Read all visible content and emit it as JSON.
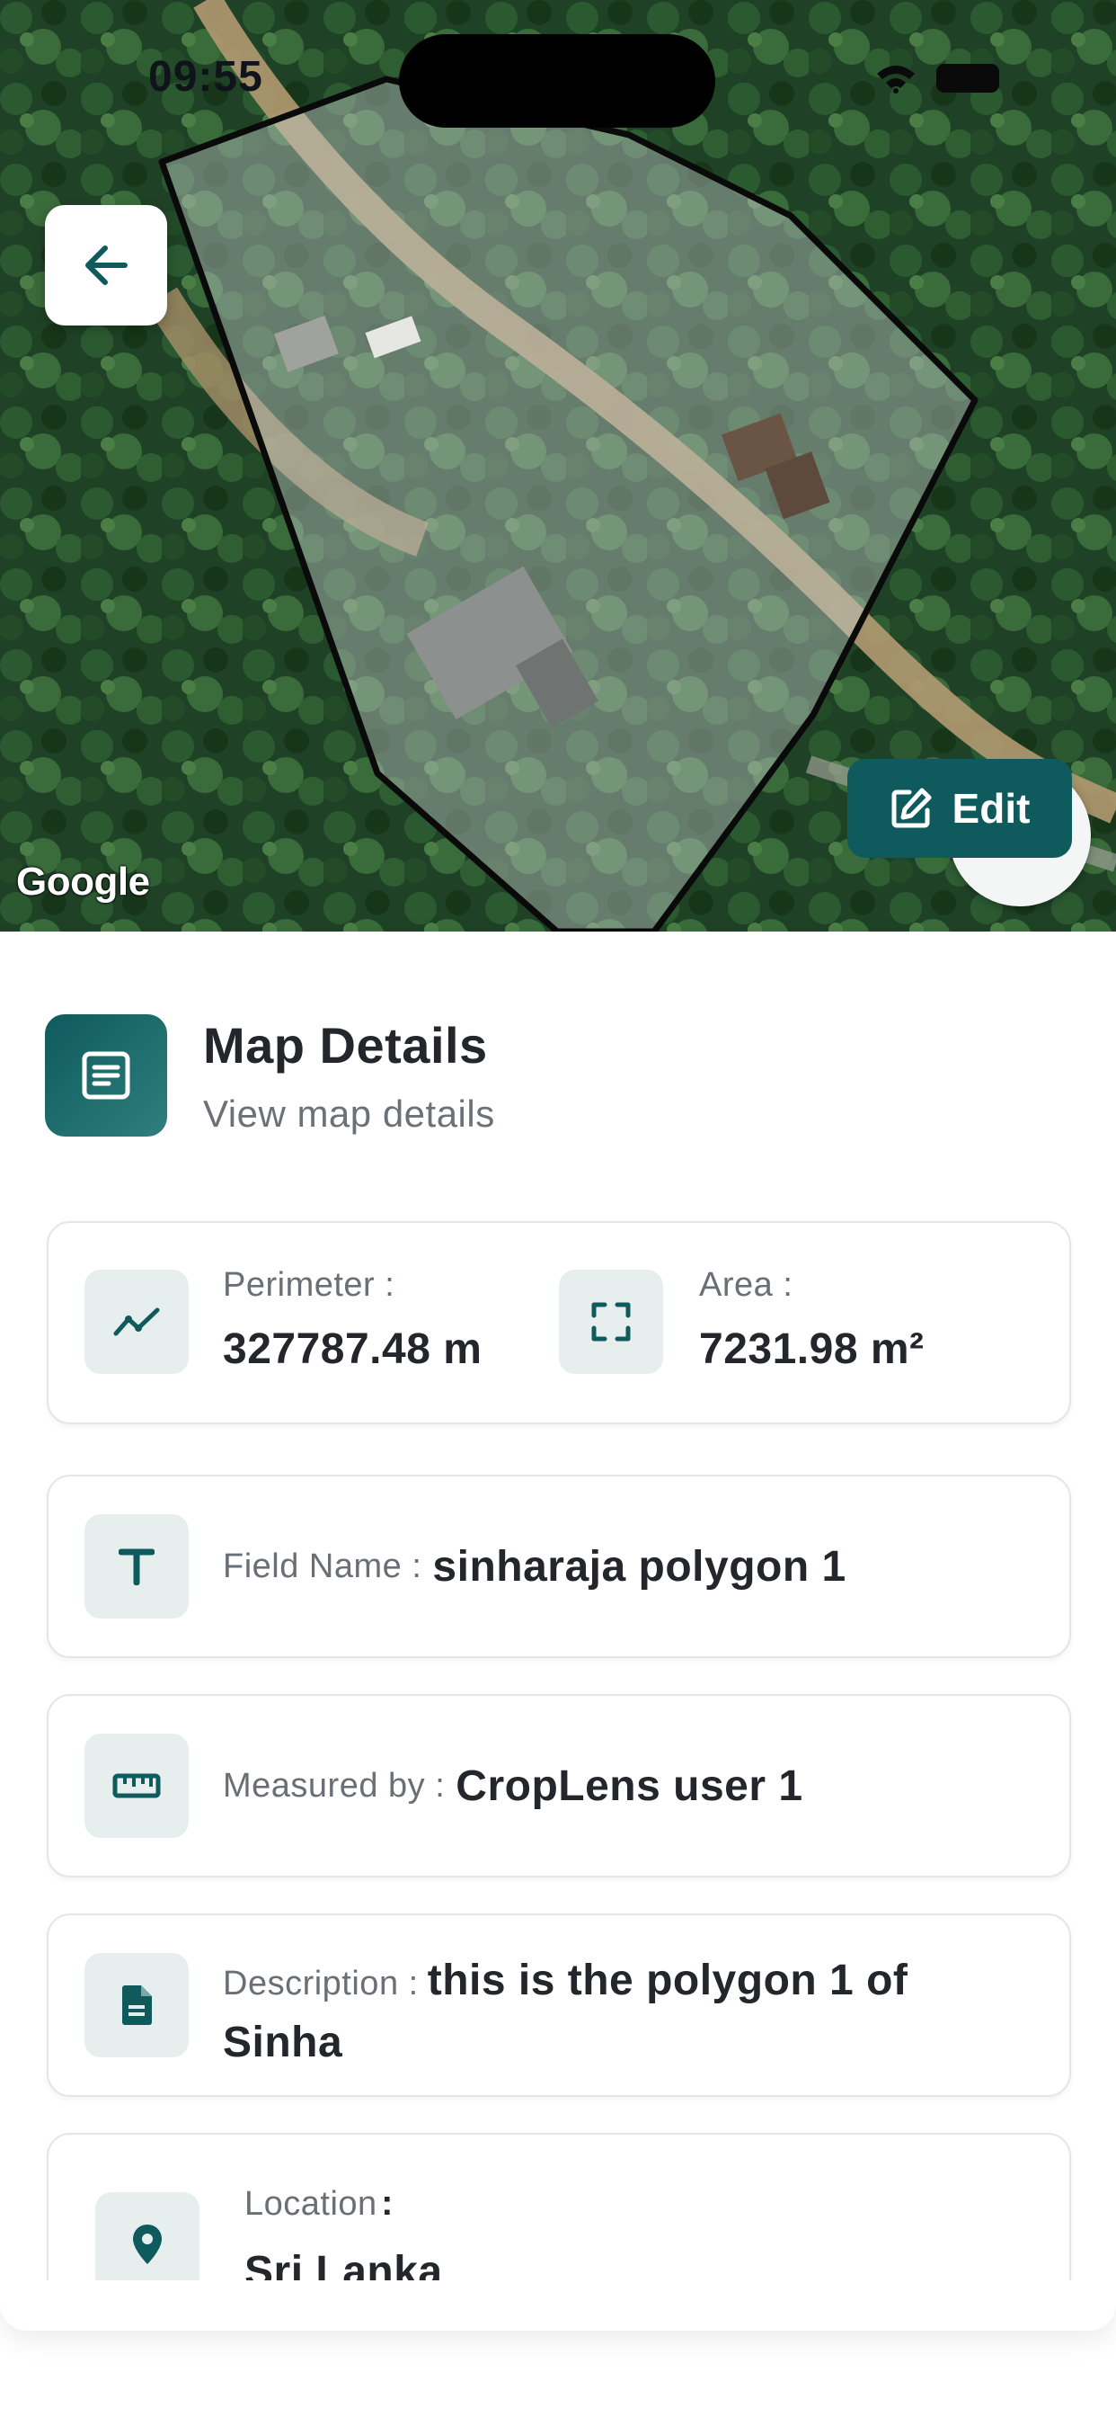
{
  "status_bar": {
    "time": "09:55"
  },
  "map": {
    "attribution": "Google",
    "back_icon": "arrow-left-icon",
    "edit_label": "Edit",
    "edit_icon": "pencil-square-icon"
  },
  "header": {
    "title": "Map Details",
    "subtitle": "View map details",
    "icon": "document-icon"
  },
  "metrics": {
    "perimeter_label": "Perimeter :",
    "perimeter_value": "327787.48 m",
    "area_label": "Area :",
    "area_value": "7231.98 m²"
  },
  "fields": {
    "field_name_label": "Field Name :",
    "field_name_value": "sinharaja polygon 1",
    "measured_by_label": "Measured by :",
    "measured_by_value": "CropLens user 1",
    "description_label": "Description :",
    "description_value": "this is the polygon 1 of Sinha",
    "location_label": "Location",
    "location_colon": ":",
    "location_value": "Sri Lanka"
  },
  "colors": {
    "accent": "#0f5a5c",
    "icon_bg": "#e6efee",
    "card_border": "#e3e6e8"
  }
}
